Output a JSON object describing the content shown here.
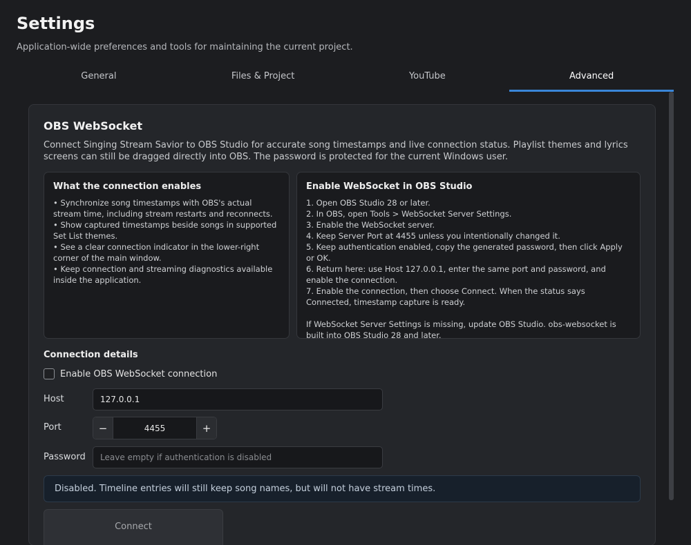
{
  "header": {
    "title": "Settings",
    "subtitle": "Application-wide preferences and tools for maintaining the current project."
  },
  "tabs": [
    {
      "label": "General",
      "active": false
    },
    {
      "label": "Files & Project",
      "active": false
    },
    {
      "label": "YouTube",
      "active": false
    },
    {
      "label": "Advanced",
      "active": true
    }
  ],
  "card": {
    "title": "OBS WebSocket",
    "description": "Connect Singing Stream Savior to OBS Studio for accurate song timestamps and live connection status. Playlist themes and lyrics screens can still be dragged directly into OBS. The password is protected for the current Windows user.",
    "enables_box": {
      "heading": "What the connection enables",
      "lines": [
        "• Synchronize song timestamps with OBS's actual stream time, including stream restarts and reconnects.",
        "• Show captured timestamps beside songs in supported Set List themes.",
        "• See a clear connection indicator in the lower-right corner of the main window.",
        "• Keep connection and streaming diagnostics available inside the application."
      ]
    },
    "steps_box": {
      "heading": "Enable WebSocket in OBS Studio",
      "lines": [
        "1. Open OBS Studio 28 or later.",
        "2. In OBS, open Tools > WebSocket Server Settings.",
        "3. Enable the WebSocket server.",
        "4. Keep Server Port at 4455 unless you intentionally changed it.",
        "5. Keep authentication enabled, copy the generated password, then click Apply or OK.",
        "6. Return here: use Host 127.0.0.1, enter the same port and password, and enable the connection.",
        "7. Enable the connection, then choose Connect. When the status says Connected, timestamp capture is ready."
      ],
      "note": "If WebSocket Server Settings is missing, update OBS Studio. obs-websocket is built into OBS Studio 28 and later."
    },
    "connection": {
      "section_label": "Connection details",
      "enable_label": "Enable OBS WebSocket connection",
      "enable_checked": false,
      "host_label": "Host",
      "host_value": "127.0.0.1",
      "port_label": "Port",
      "port_value": "4455",
      "port_minus": "−",
      "port_plus": "+",
      "password_label": "Password",
      "password_placeholder": "Leave empty if authentication is disabled",
      "status_text": "Disabled. Timeline entries will still keep song names, but will not have stream times.",
      "connect_label": "Connect"
    }
  },
  "colors": {
    "background": "#1c1d20",
    "accent": "#3a86d8",
    "card": "#24262a"
  }
}
